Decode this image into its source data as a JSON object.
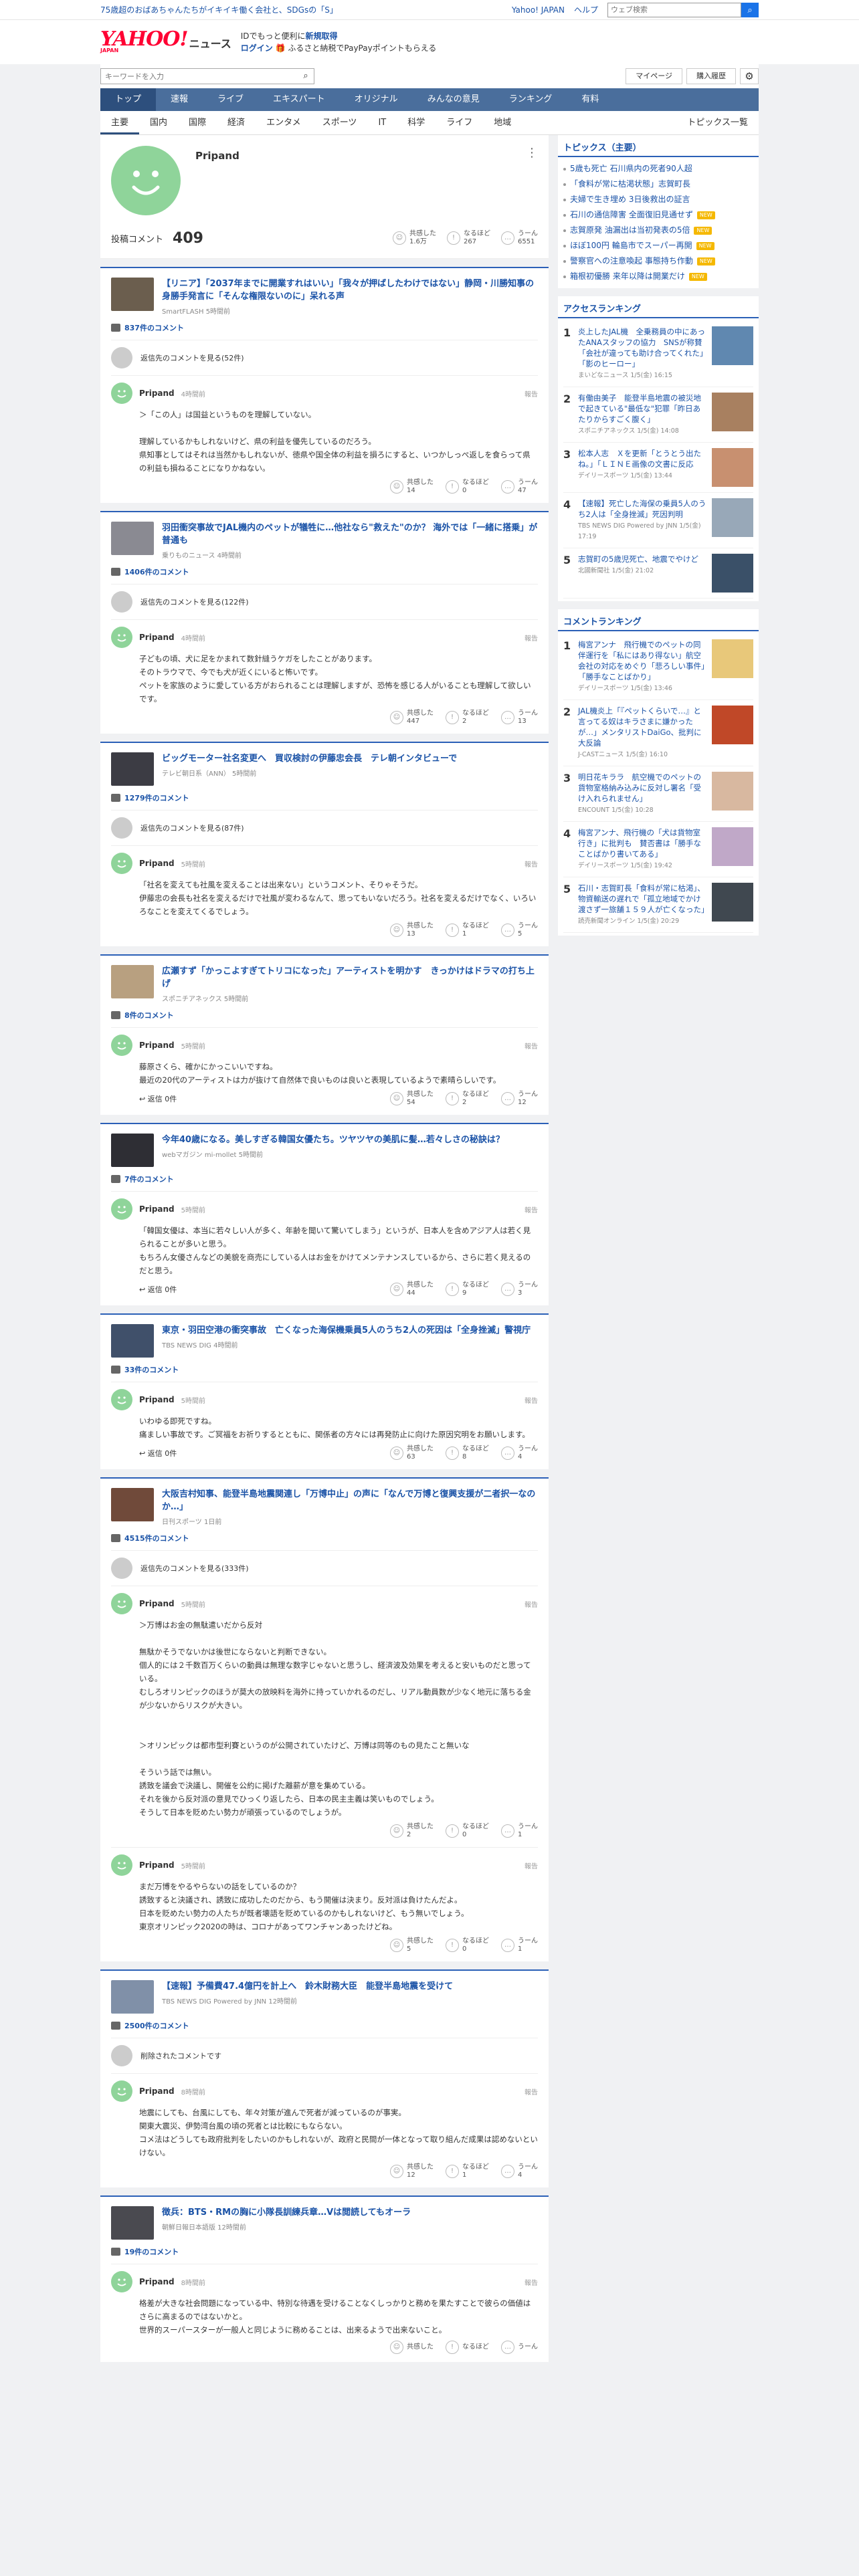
{
  "topbar": {
    "promo": "75歳超のおばあちゃんたちがイキイキ働く会社と、SDGsの「S」",
    "links": [
      "Yahoo! JAPAN",
      "ヘルプ"
    ],
    "search_placeholder": "ウェブ検索"
  },
  "header": {
    "logo_main": "YAHOO!",
    "logo_sub": "JAPAN",
    "logo_news": "ニュース",
    "promo_line1_pre": "IDでもっと便利に",
    "promo_line1_link": "新規取得",
    "promo_line2_link": "ログイン",
    "promo_line2_rest": "ふるさと納税でPayPayポイントもらえる"
  },
  "search": {
    "placeholder": "キーワードを入力",
    "mypage": "マイページ",
    "history": "購入履歴"
  },
  "nav_main": [
    "トップ",
    "速報",
    "ライブ",
    "エキスパート",
    "オリジナル",
    "みんなの意見",
    "ランキング",
    "有料"
  ],
  "nav_sub": [
    "主要",
    "国内",
    "国際",
    "経済",
    "エンタメ",
    "スポーツ",
    "IT",
    "科学",
    "ライフ",
    "地域"
  ],
  "nav_sub_right": "トピックス一覧",
  "profile": {
    "name": "Pripand",
    "comment_label": "投稿コメント",
    "comment_count": "409",
    "reactions": [
      {
        "label": "共感した",
        "value": "1.6万"
      },
      {
        "label": "なるほど",
        "value": "267"
      },
      {
        "label": "うーん",
        "value": "6551"
      }
    ]
  },
  "common": {
    "user": "Pripand",
    "report": "報告",
    "reply": "返信 0件",
    "r1": "共感した",
    "r2": "なるほど",
    "r3": "うーん"
  },
  "articles": [
    {
      "title": "【リニア】「2037年までに開業すれはいい」「我々が押ばしたわけではない」静岡・川勝知事の身勝手発言に「そんな権限ないのに」呆れる声",
      "source": "SmartFLASH 5時間前",
      "count": "837件のコメント",
      "view": "返信先のコメントを見る(52件)",
      "time": "4時間前",
      "body": "＞「この人」は国益というものを理解していない。\n\n理解しているかもしれないけど、県の利益を優先しているのだろう。\n県知事としてはそれは当然かもしれないが、徳県や国全体の利益を損ろにすると、いつかしっぺ返しを食らって県の利益も損ねることになりかねない。",
      "reacts": [
        "14",
        "0",
        "47"
      ]
    },
    {
      "title": "羽田衝突事故でJAL機内のペットが犠牲に…他社なら\"救えた\"のか？ 海外では「一緒に搭乗」が普通も",
      "source": "乗りものニュース 4時間前",
      "count": "1406件のコメント",
      "view": "返信先のコメントを見る(122件)",
      "time": "4時間前",
      "body": "子どもの頃、犬に足をかまれて数針縫うケガをしたことがあります。\nそのトラウマで、今でも犬が近くにいると怖いです。\nペットを家族のように愛している方がおられることは理解しますが、恐怖を感じる人がいることも理解して欲しいです。",
      "reacts": [
        "447",
        "2",
        "13"
      ]
    },
    {
      "title": "ビッグモーター社名変更へ　買収検討の伊藤忠会長　テレ朝インタビューで",
      "source": "テレビ朝日系（ANN） 5時間前",
      "count": "1279件のコメント",
      "view": "返信先のコメントを見る(87件)",
      "time": "5時間前",
      "body": "「社名を変えても社風を変えることは出来ない」というコメント、そりゃそうだ。\n伊藤忠の会長も社名を変えるだけで社風が変わるなんて、思ってもいないだろう。社名を変えるだけでなく、いろいろなことを変えてくるでしょう。",
      "reacts": [
        "13",
        "1",
        "5"
      ]
    },
    {
      "title": "広瀬すず「かっこよすぎてトリコになった」アーティストを明かす　きっかけはドラマの打ち上げ",
      "source": "スポニチアネックス 5時間前",
      "count": "8件のコメント",
      "view": "",
      "time": "5時間前",
      "body": "藤原さくら、確かにかっこいいですね。\n最近の20代のアーティストは力が抜けて自然体で良いものは良いと表現しているようで素晴らしいです。",
      "reacts": [
        "54",
        "2",
        "12"
      ],
      "reply": true
    },
    {
      "title": "今年40歳になる。美しすぎる韓国女優たち。ツヤツヤの美肌に髪…若々しさの秘訣は？",
      "source": "webマガジン mi-mollet 5時間前",
      "count": "7件のコメント",
      "view": "",
      "time": "5時間前",
      "body": "「韓国女優は、本当に若々しい人が多く、年齢を聞いて驚いてしまう」というが、日本人を含めアジア人は若く見られることが多いと思う。\nもちろん女優さんなどの美貌を商売にしている人はお金をかけてメンテナンスしているから、さらに若く見えるのだと思う。",
      "reacts": [
        "44",
        "9",
        "3"
      ],
      "reply": true
    },
    {
      "title": "東京・羽田空港の衝突事故　亡くなった海保機乗員5人のうち2人の死因は「全身挫滅」警視庁",
      "source": "TBS NEWS DIG 4時間前",
      "count": "33件のコメント",
      "view": "",
      "time": "5時間前",
      "body": "いわゆる即死ですね。\n痛ましい事故です。ご冥福をお祈りするとともに、関係者の方々には再発防止に向けた原因究明をお願いします。",
      "reacts": [
        "63",
        "8",
        "4"
      ],
      "reply": true
    },
    {
      "title": "大阪吉村知事、能登半島地震関連し「万博中止」の声に「なんで万博と復興支援が二者択一なのか…」",
      "source": "日刊スポーツ 1日前",
      "count": "4515件のコメント",
      "view": "返信先のコメントを見る(333件)",
      "time": "5時間前",
      "body": "＞万博はお金の無駄遣いだから反対\n\n無駄かそうでないかは後世にならないと判断できない。\n個人的には２千数百万くらいの動員は無理な数字じゃないと思うし、経済波及効果を考えると安いものだと思っている。\nむしろオリンピックのほうが莫大の放映料を海外に持っていかれるのだし、リアル動員数が少なく地元に落ちる金が少ないからリスクが大きい。\n\n\n＞オリンピックは都市型利賽というのが公開されていたけど、万博は同等のもの見たこと無いな\n\nそういう話では無い。\n誘致を議会で決議し、開催を公約に掲げた離薪が意を集めている。\nそれを後から反対派の意見でひっくり返したら、日本の民主主義は笑いものでしょう。\nそうして日本を貶めたい勢力が頑張っているのでしょうが。",
      "reacts": [
        "2",
        "0",
        "1"
      ]
    },
    {
      "title": "【速報】予備費47.4億円を計上へ　鈴木財務大臣　能登半島地震を受けて",
      "source": "TBS NEWS DIG Powered by JNN 12時間前",
      "count": "2500件のコメント",
      "view": "削除されたコメントです",
      "time": "8時間前",
      "body": "地震にしても、台風にしても、年々対策が進んで死者が減っているのが事実。\n関東大震災、伊勢湾台風の頃の死者とは比較にもならない。\nコメ法はどうしても政府批判をしたいのかもしれないが、政府と民間が一体となって取り組んだ成果は認めないといけない。",
      "reacts": [
        "12",
        "1",
        "4"
      ]
    },
    {
      "title": "徴兵：BTS・RMの胸に小隊長訓練兵章…Vは閲読してもオーラ",
      "source": "朝鮮日報日本語版 12時間前",
      "count": "19件のコメント",
      "view": "",
      "time": "8時間前",
      "body": "格差が大きな社会問題になっている中、特別な待遇を受けることなくしっかりと務めを果たすことで彼らの価値はさらに高まるのではないかと。\n世界的スーパースターが一般人と同じように務めることは、出来るようで出来ないこと。",
      "reacts": [
        "",
        "",
        ""
      ]
    }
  ],
  "extra_comment": {
    "time": "5時間前",
    "body": "まだ万博をやるやらないの話をしているのか？\n誘致すると決議され、誘致に成功したのだから、もう開催は決まり。反対派は負けたんだよ。\n日本を貶めたい勢力の人たちが既者壊語を貶めているのかもしれないけど、もう無いでしょう。\n東京オリンピック2020の時は、コロナがあってワンチャンあったけどね。",
    "reacts": [
      "5",
      "0",
      "1"
    ]
  },
  "sidebar": {
    "topics_title": "トピックス（主要）",
    "topics": [
      {
        "t": "5歳も死亡 石川県内の死者90人超",
        "new": false
      },
      {
        "t": "「食料が常に枯渇状態」志賀町長",
        "new": false
      },
      {
        "t": "夫婦で生き埋め 3日後救出の証言",
        "new": false
      },
      {
        "t": "石川の通信障害 全面復旧見通せず",
        "new": true
      },
      {
        "t": "志賀原発 油漏出は当初発表の5倍",
        "new": true
      },
      {
        "t": "ほぼ100円 輪島市でスーパー再開",
        "new": true
      },
      {
        "t": "警察官への注意喚起 事態持ち作動",
        "new": true
      },
      {
        "t": "箱根初優勝 来年以降は開業だけ",
        "new": true
      }
    ],
    "new_badge": "NEW",
    "access_title": "アクセスランキング",
    "access": [
      {
        "title": "炎上したJAL機　全乗務員の中にあったANAスタッフの協力　SNSが称賛「会社が違っても助け合ってくれた」「影のヒーロー」",
        "src": "まいどなニュース 1/5(金) 16:15"
      },
      {
        "title": "有働由美子　能登半島地震の被災地で起きている\"最低な\"犯罪「昨日あたりからすごく腹く」",
        "src": "スポニチアネックス 1/5(金) 14:08"
      },
      {
        "title": "松本人志　Ｘを更新「とうとう出たね。」「ＬＩＮＥ画像の文書に反応",
        "src": "デイリースポーツ 1/5(金) 13:44"
      },
      {
        "title": "【速報】死亡した海保の乗員5人のうち2人は「全身挫滅」死因判明",
        "src": "TBS NEWS DIG Powered by JNN 1/5(金) 17:19"
      },
      {
        "title": "志賀町の5歳児死亡、地震でやけど",
        "src": "北國新聞社 1/5(金) 21:02"
      }
    ],
    "comment_title": "コメントランキング",
    "comments": [
      {
        "title": "梅宮アンナ　飛行機でのペットの同伴運行を「私にはあり得ない」航空会社の対応をめぐり「悲ろしい事件」「勝手なことばかり」",
        "src": "デイリースポーツ 1/5(金) 13:46"
      },
      {
        "title": "JAL機炎上「『ペットくらいで…』と言ってる奴はキラさまに嫌かったが…」メンタリストDaiGo、批判に大反論",
        "src": "J-CASTニュース 1/5(金) 16:10"
      },
      {
        "title": "明日花キララ　航空機でのペットの貨物室格納み込みに反対し署名「受け入れられません」",
        "src": "ENCOUNT 1/5(金) 10:28"
      },
      {
        "title": "梅宮アンナ、飛行機の「犬は貨物室行き」に批判も　賛否書は「勝手なことばかり書いてある」",
        "src": "デイリースポーツ 1/5(金) 19:42"
      },
      {
        "title": "石川・志賀町長「食料が常に枯渇」、物資輸送の遅れで「孤立地域でかけ渡さず一旅舗１５９人が亡くなった」",
        "src": "読売新聞オンライン 1/5(金) 20:29"
      }
    ]
  },
  "colors": {
    "accent": "#2b60b7",
    "nav": "#4a6e9c",
    "avatar": "#8fd49a",
    "new_badge": "#f5b800"
  }
}
